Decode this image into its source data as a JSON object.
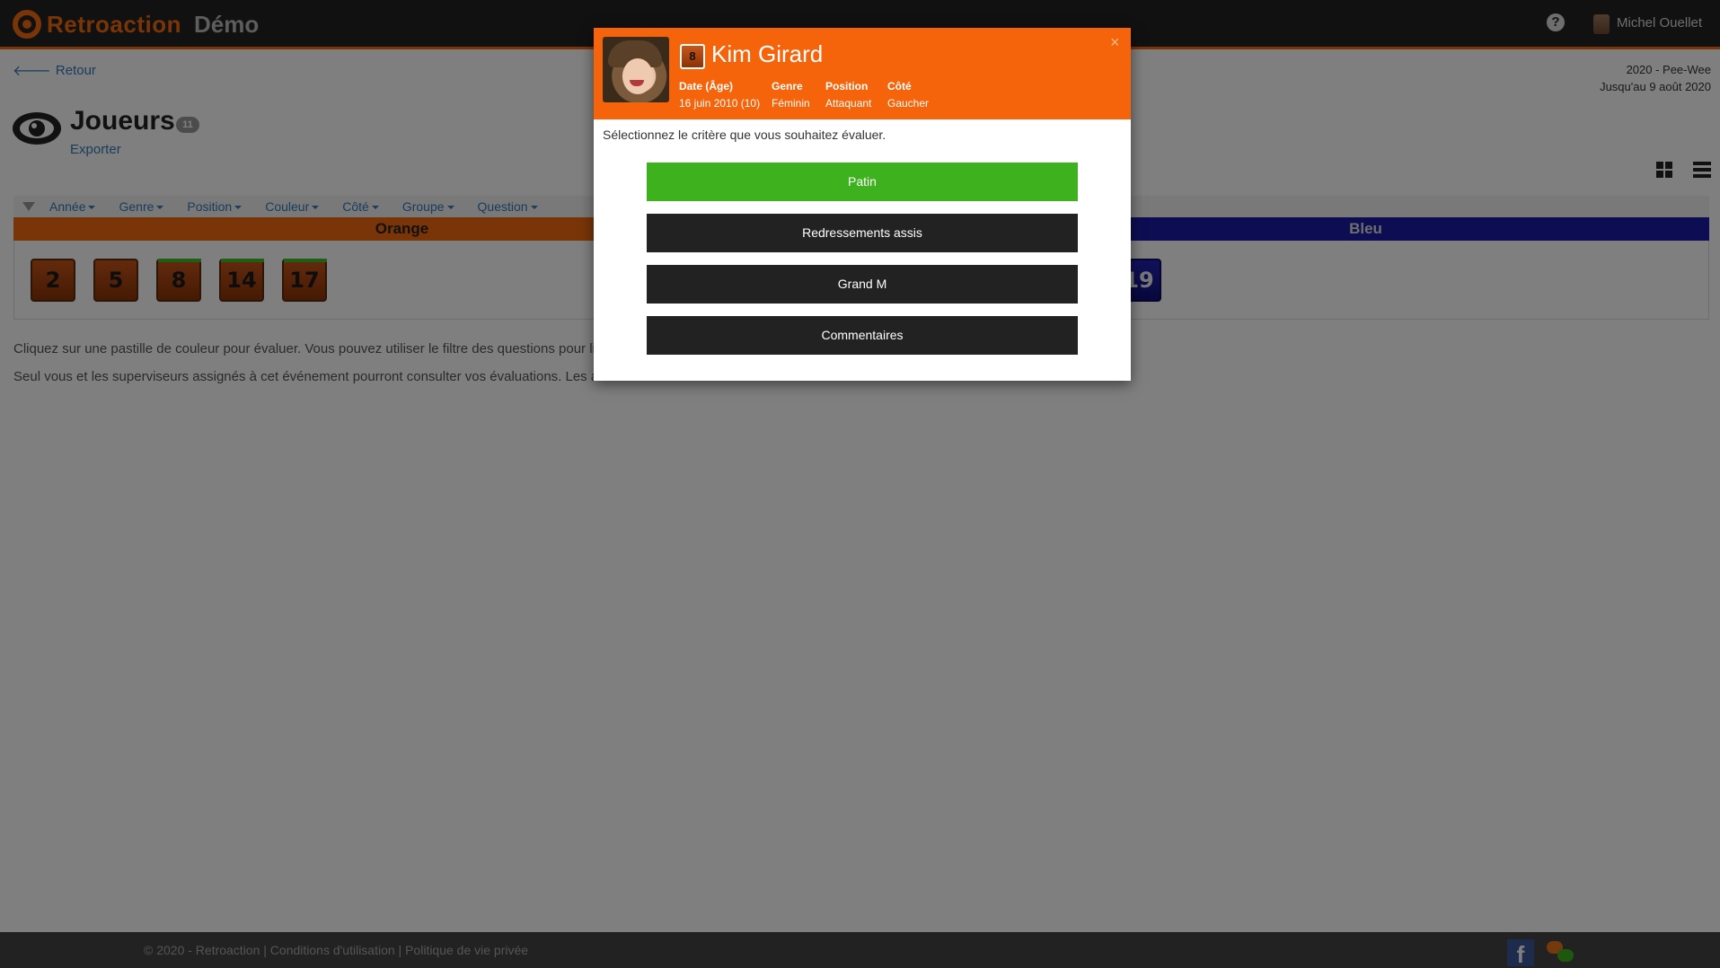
{
  "navbar": {
    "brand": "Retroaction",
    "subtitle": "Démo",
    "help_icon": "question-circle-icon",
    "user_name": "Michel Ouellet"
  },
  "page": {
    "back_label": "Retour",
    "season_line1": "2020 - Pee-Wee",
    "season_line2": "Jusqu'au 9 août 2020",
    "title": "Joueurs",
    "count": "11",
    "export_label": "Exporter"
  },
  "filters": [
    "Année",
    "Genre",
    "Position",
    "Couleur",
    "Côté",
    "Groupe",
    "Question"
  ],
  "teams": {
    "orange": {
      "name": "Orange",
      "color": "#f26a10",
      "players": [
        "2",
        "5",
        "8",
        "14",
        "17"
      ]
    },
    "blue": {
      "name": "Bleu",
      "color": "#1a1aa6",
      "players": [
        "19"
      ]
    }
  },
  "help": {
    "line1": "Cliquez sur une pastille de couleur pour évaluer. Vous pouvez utiliser le filtre des questions pour limiter l",
    "line2": "Seul vous et les superviseurs assignés à cet événement pourront consulter vos évaluations. Les autres é"
  },
  "footer": {
    "text": "© 2020 - Retroaction | Conditions d'utilisation | Politique de vie privée"
  },
  "modal": {
    "number": "8",
    "name": "Kim Girard",
    "close": "×",
    "meta": [
      {
        "label": "Date (Âge)",
        "value": "16 juin 2010 (10)"
      },
      {
        "label": "Genre",
        "value": "Féminin"
      },
      {
        "label": "Position",
        "value": "Attaquant"
      },
      {
        "label": "Côté",
        "value": "Gaucher"
      }
    ],
    "instruction": "Sélectionnez le critère que vous souhaitez évaluer.",
    "criteria": [
      "Patin",
      "Redressements assis",
      "Grand M",
      "Commentaires"
    ],
    "active_color": "#3db11e",
    "header_color": "#f5640a"
  }
}
